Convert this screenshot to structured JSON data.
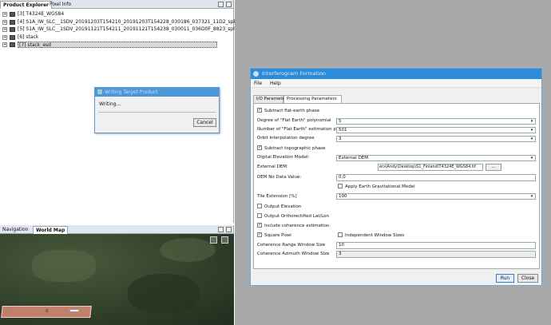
{
  "product_explorer": {
    "tabs": [
      "Product Explorer",
      "Pixel Info"
    ],
    "products": [
      "[3] T4324E_WGS84",
      "[4] S1A_IW_SLC__1SDV_20191203T154210_20191203T154228_030186_037321_11D2_split",
      "[5] S1A_IW_SLC__1SDV_20191121T154211_20191121T154238_030011_036D0F_8823_split",
      "[6] stack",
      "[7] stack_esd"
    ]
  },
  "writing_dialog": {
    "title": "Writing Target Product",
    "message": "Writing...",
    "cancel": "Cancel"
  },
  "nav": {
    "tabs": [
      "Navigation",
      "World Map"
    ],
    "footprint_label": "8"
  },
  "interferogram": {
    "title": "Interferogram Formation",
    "menu": [
      "File",
      "Help"
    ],
    "tabs": [
      "I/O Parameters",
      "Processing Parameters"
    ],
    "subtract_flat_earth": "Subtract flat-earth phase",
    "degree_label": "Degree of \"Flat Earth\" polynomial",
    "degree_value": "5",
    "points_label": "Number of \"Flat Earth\" estimation points",
    "points_value": "501",
    "orbit_label": "Orbit interpolation degree",
    "orbit_value": "3",
    "subtract_topo": "Subtract topographic phase",
    "dem_model_label": "Digital Elevation Model:",
    "dem_model_value": "External DEM",
    "ext_dem_label": "External DEM:",
    "ext_dem_value": "ers\\Andy\\Desktop\\S1_Finland\\T4324E_WGS84.tif",
    "browse": "...",
    "nodata_label": "DEM No Data Value:",
    "nodata_value": "0.0",
    "gravitational": "Apply Earth Gravitational Model",
    "tile_label": "Tile Extension [%]",
    "tile_value": "100",
    "output_elevation": "Output Elevation",
    "output_ortho": "Output Orthorectified Lat/Lon",
    "include_coherence": "Include coherence estimation",
    "square_pixel": "Square Pixel",
    "independent": "Independent Window Sizes",
    "range_label": "Coherence Range Window Size",
    "range_value": "10",
    "azimuth_label": "Coherence Azimuth Window Size",
    "azimuth_value": "3",
    "run": "Run",
    "close": "Close"
  }
}
